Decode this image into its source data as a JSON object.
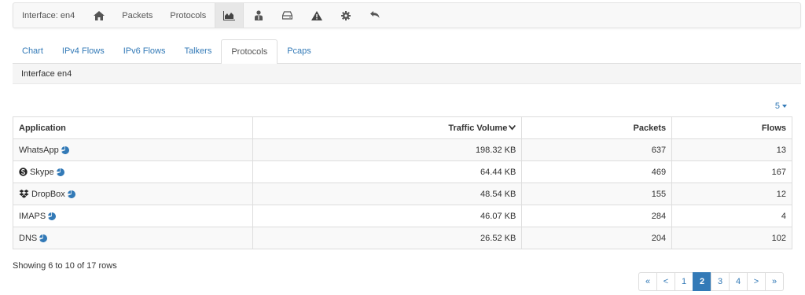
{
  "navbar": {
    "interface_label": "Interface: en4",
    "items": [
      {
        "label": "Packets"
      },
      {
        "label": "Protocols"
      }
    ],
    "icons": [
      "home-icon",
      "area-chart-icon",
      "users-icon",
      "drive-icon",
      "warning-icon",
      "gear-icon",
      "undo-icon"
    ]
  },
  "tabs": [
    {
      "label": "Chart",
      "active": false
    },
    {
      "label": "IPv4 Flows",
      "active": false
    },
    {
      "label": "IPv6 Flows",
      "active": false
    },
    {
      "label": "Talkers",
      "active": false
    },
    {
      "label": "Protocols",
      "active": true
    },
    {
      "label": "Pcaps",
      "active": false
    }
  ],
  "interface_title": "Interface en4",
  "page_size": "5",
  "table": {
    "headers": {
      "application": "Application",
      "traffic_volume": "Traffic Volume",
      "packets": "Packets",
      "flows": "Flows"
    },
    "rows": [
      {
        "application": "WhatsApp",
        "icon": "none",
        "traffic_volume": "198.32 KB",
        "packets": "637",
        "flows": "13"
      },
      {
        "application": "Skype",
        "icon": "skype-icon",
        "traffic_volume": "64.44 KB",
        "packets": "469",
        "flows": "167"
      },
      {
        "application": "DropBox",
        "icon": "dropbox-icon",
        "traffic_volume": "48.54 KB",
        "packets": "155",
        "flows": "12"
      },
      {
        "application": "IMAPS",
        "icon": "none",
        "traffic_volume": "46.07 KB",
        "packets": "284",
        "flows": "4"
      },
      {
        "application": "DNS",
        "icon": "none",
        "traffic_volume": "26.52 KB",
        "packets": "204",
        "flows": "102"
      }
    ]
  },
  "footer": {
    "rows_info": "Showing 6 to 10 of 17 rows",
    "pagination": {
      "first": "«",
      "prev": "<",
      "pages": [
        "1",
        "2",
        "3",
        "4"
      ],
      "current": "2",
      "next": ">",
      "last": "»"
    }
  },
  "colors": {
    "link": "#337ab7",
    "active_page": "#337ab7",
    "navbar_bg": "#f8f8f8",
    "striped_row": "#f9f9f9"
  }
}
